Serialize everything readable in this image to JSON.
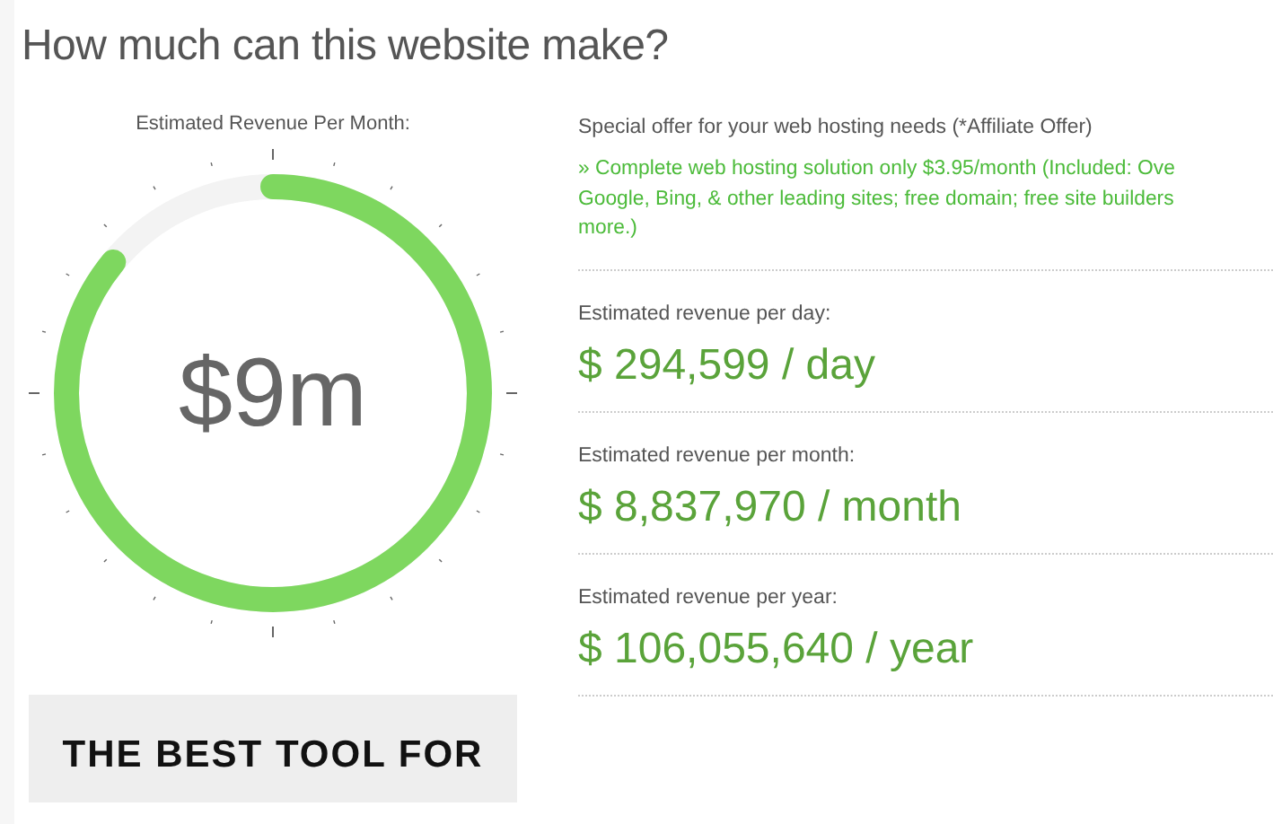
{
  "title": "How much can this website make?",
  "gauge": {
    "label": "Estimated Revenue Per Month:",
    "value": "$9m",
    "level": 0.86
  },
  "promo": {
    "text": "THE BEST TOOL FOR"
  },
  "offer": {
    "heading": "Special offer for your web hosting needs (*Affiliate Offer)",
    "lines": [
      "» Complete web hosting solution only $3.95/month (Included: Ove",
      "Google, Bing, & other leading sites; free domain; free site builders",
      "more.)"
    ]
  },
  "estimates": [
    {
      "label": "Estimated revenue per day:",
      "value": "$ 294,599 / day"
    },
    {
      "label": "Estimated revenue per month:",
      "value": "$ 8,837,970 / month"
    },
    {
      "label": "Estimated revenue per year:",
      "value": "$ 106,055,640 / year"
    }
  ]
}
